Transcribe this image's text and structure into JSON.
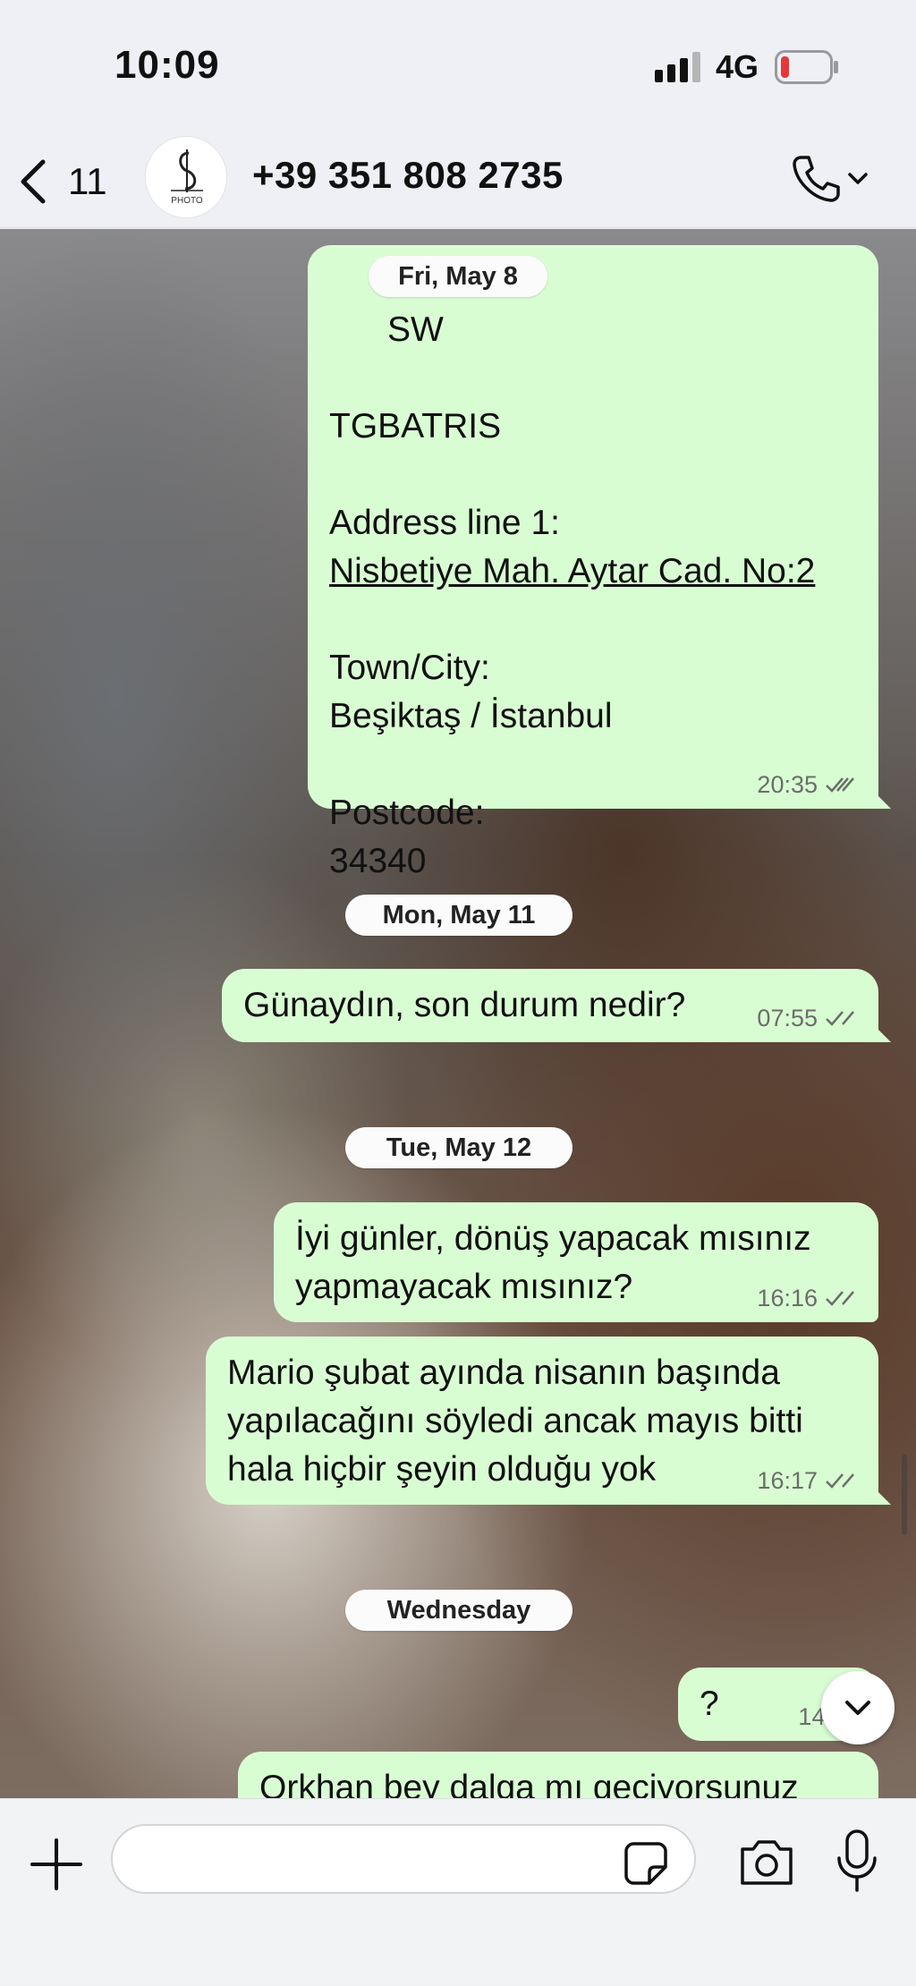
{
  "status_bar": {
    "time": "10:09",
    "network": "4G",
    "signal_icon": "signal-bars-icon",
    "battery_icon": "battery-low-icon",
    "battery_color": "#e5383b"
  },
  "header": {
    "back_count": "11",
    "avatar_text": "PHOTO",
    "contact_name": "+39 351 808 2735",
    "call_icon": "phone-icon"
  },
  "chat": {
    "bubble_color": "#d9fdd3",
    "messages": [
      {
        "partial_line": "SW",
        "line1": "TGBATRIS",
        "address_label": "Address line 1:",
        "address_value": "Nisbetiye Mah. Aytar Cad. No:2",
        "town_label": "Town/City:",
        "town_value": "Beşiktaş / İstanbul",
        "postcode_label": "Postcode:",
        "postcode_value": "34340",
        "time": "20:35"
      },
      {
        "text": "Günaydın, son durum nedir?",
        "time": "07:55"
      },
      {
        "text": "İyi günler, dönüş yapacak mısınız\nyapmayacak mısınız?",
        "time": "16:16"
      },
      {
        "text": "Mario şubat ayında nisanın başında\nyapılacağını söyledi ancak mayıs bitti\nhala hiçbir şeyin olduğu yok",
        "time": "16:17"
      },
      {
        "text": "?",
        "time": "14:57"
      },
      {
        "text": "Orkhan bey dalga mı geçiyorsunuz"
      }
    ],
    "date_pills": [
      "Fri, May 8",
      "Mon, May 11",
      "Tue, May 12",
      "Wednesday"
    ]
  },
  "input_bar": {
    "placeholder": "",
    "value": ""
  }
}
